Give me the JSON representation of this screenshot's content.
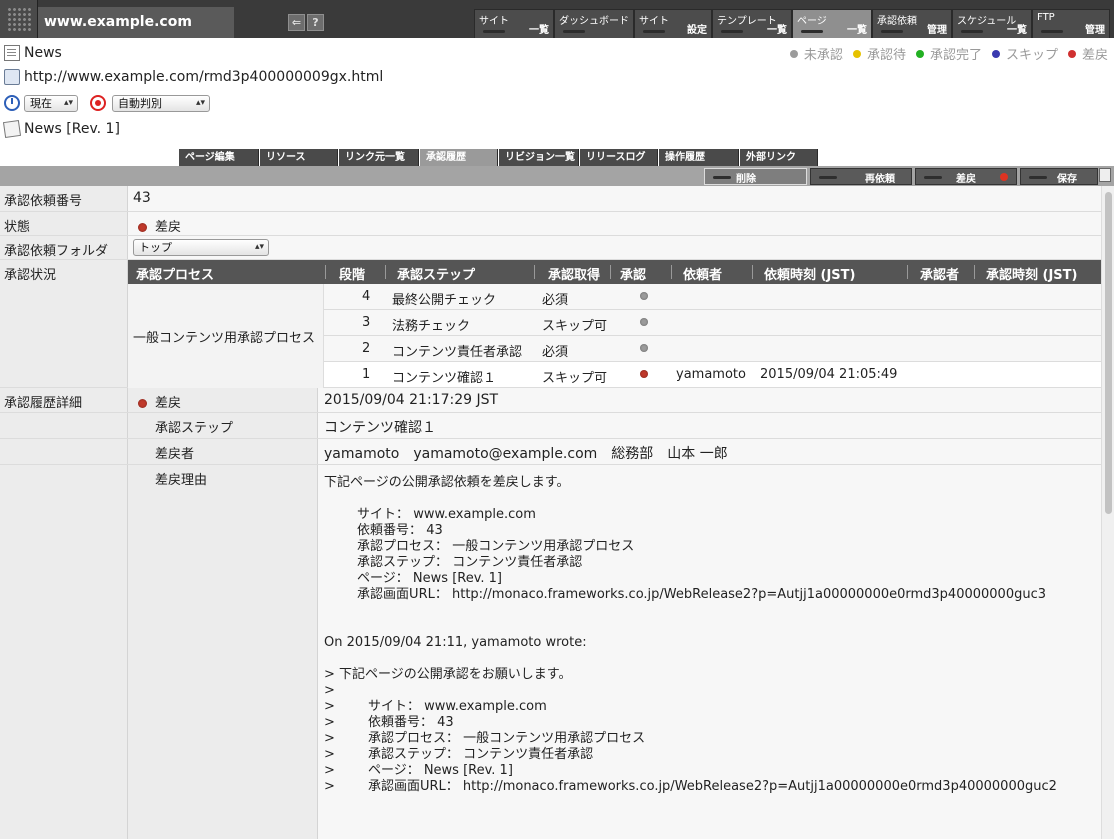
{
  "header": {
    "site_name": "www.example.com",
    "back_icon": "back-arrow-icon",
    "help_label": "?"
  },
  "topnav": [
    {
      "line1": "サイト",
      "line2": "一覧"
    },
    {
      "line1": "ダッシュボード",
      "line2": ""
    },
    {
      "line1": "サイト",
      "line2": "設定"
    },
    {
      "line1": "テンプレート",
      "line2": "一覧"
    },
    {
      "line1": "ページ",
      "line2": "一覧"
    },
    {
      "line1": "承認依頼",
      "line2": "管理"
    },
    {
      "line1": "スケジュール",
      "line2": "一覧"
    },
    {
      "line1": "FTP",
      "line2": "管理"
    }
  ],
  "page": {
    "name": "News",
    "url": "http://www.example.com/rmd3p400000009gx.html",
    "time_select": "現在",
    "mode_select": "自動判別",
    "revision": "News [Rev. 1]"
  },
  "legend": [
    {
      "label": "未承認",
      "color": "#9b9b9b"
    },
    {
      "label": "承認待",
      "color": "#e6c200"
    },
    {
      "label": "承認完了",
      "color": "#22b022"
    },
    {
      "label": "スキップ",
      "color": "#3a3ab0"
    },
    {
      "label": "差戻",
      "color": "#d03030"
    }
  ],
  "tabs": [
    "ページ編集",
    "リソース",
    "リンク元一覧",
    "承認履歴",
    "リビジョン一覧",
    "リリースログ",
    "操作履歴",
    "外部リンク"
  ],
  "actions": {
    "delete": "削除",
    "resubmit": "再依頼",
    "remand": "差戻",
    "save": "保存"
  },
  "form": {
    "request_no_label": "承認依頼番号",
    "request_no": "43",
    "status_label": "状態",
    "status": "差戻",
    "folder_label": "承認依頼フォルダ",
    "folder": "トップ",
    "approval_status_label": "承認状況",
    "history_label": "承認履歴詳細"
  },
  "approval_table": {
    "headers": [
      "承認プロセス",
      "段階",
      "承認ステップ",
      "承認取得",
      "承認",
      "依頼者",
      "依頼時刻 (JST)",
      "承認者",
      "承認時刻 (JST)"
    ],
    "process_name": "一般コンテンツ用承認プロセス",
    "rows": [
      {
        "stage": "4",
        "step": "最終公開チェック",
        "required": "必須",
        "status": "pending",
        "requester": "",
        "time": ""
      },
      {
        "stage": "3",
        "step": "法務チェック",
        "required": "スキップ可",
        "status": "pending",
        "requester": "",
        "time": ""
      },
      {
        "stage": "2",
        "step": "コンテンツ責任者承認",
        "required": "必須",
        "status": "pending",
        "requester": "",
        "time": ""
      },
      {
        "stage": "1",
        "step": "コンテンツ確認１",
        "required": "スキップ可",
        "status": "remanded",
        "requester": "yamamoto",
        "time": "2015/09/04 21:05:49"
      }
    ]
  },
  "history": {
    "status_label": "差戻",
    "status_time": "2015/09/04 21:17:29 JST",
    "step_label": "承認ステップ",
    "step": "コンテンツ確認１",
    "remander_label": "差戻者",
    "remander": "yamamoto　yamamoto@example.com　総務部　山本 一郎",
    "reason_label": "差戻理由",
    "reason_lines": [
      "下記ページの公開承認依頼を差戻します。",
      "",
      "        サイト： www.example.com",
      "        依頼番号： 43",
      "        承認プロセス： 一般コンテンツ用承認プロセス",
      "        承認ステップ： コンテンツ責任者承認",
      "        ページ： News [Rev. 1]",
      "        承認画面URL： http://monaco.frameworks.co.jp/WebRelease2?p=Autjj1a00000000e0rmd3p40000000guc3",
      "",
      "",
      "On 2015/09/04 21:11, yamamoto wrote:",
      "",
      "> 下記ページの公開承認をお願いします。",
      ">",
      ">        サイト： www.example.com",
      ">        依頼番号： 43",
      ">        承認プロセス： 一般コンテンツ用承認プロセス",
      ">        承認ステップ： コンテンツ責任者承認",
      ">        ページ： News [Rev. 1]",
      ">        承認画面URL： http://monaco.frameworks.co.jp/WebRelease2?p=Autjj1a00000000e0rmd3p40000000guc2"
    ]
  }
}
